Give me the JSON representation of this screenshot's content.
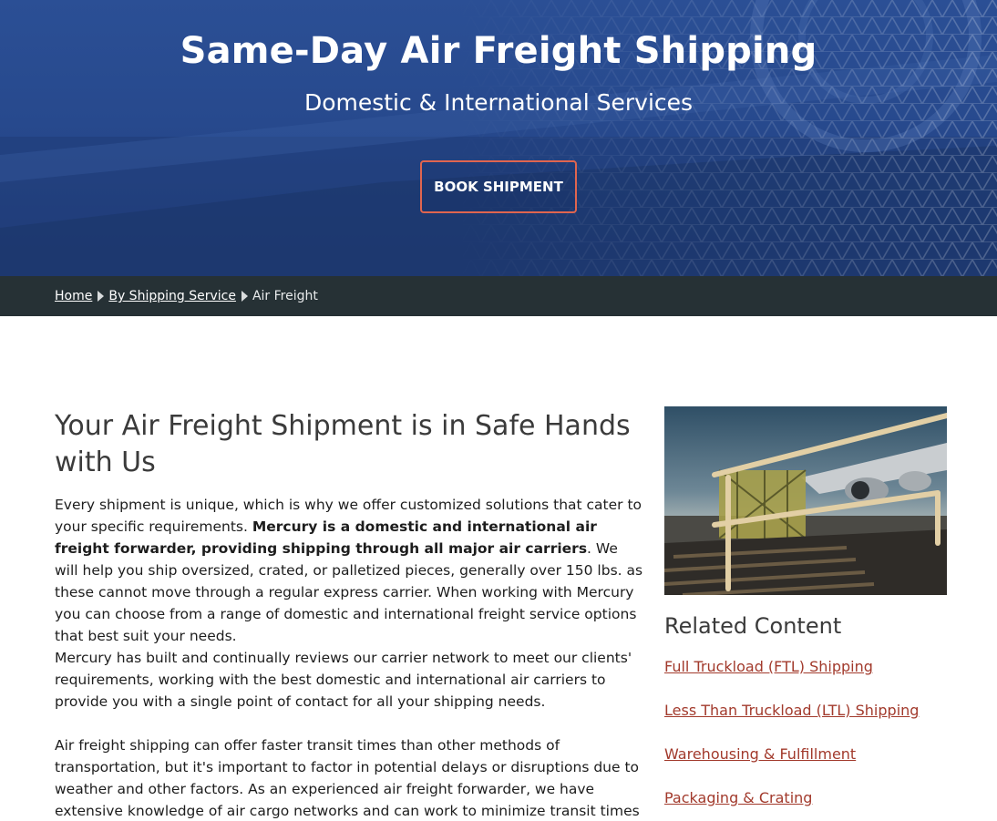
{
  "hero": {
    "title": "Same-Day Air Freight Shipping",
    "subtitle": "Domestic & International Services",
    "cta_label": "BOOK SHIPMENT"
  },
  "breadcrumb": {
    "items": [
      "Home",
      "By Shipping Service"
    ],
    "current": "Air Freight"
  },
  "main": {
    "heading": "Your Air Freight Shipment is in Safe Hands with Us",
    "p1_a": "Every shipment is unique, which is why we offer customized solutions that cater to your specific requirements. ",
    "p1_bold": "Mercury is a domestic and international air freight forwarder, providing shipping through all major air carriers",
    "p1_b": ". We will help you ship oversized, crated, or palletized pieces, generally over 150 lbs. as these cannot move through a regular express carrier. When working with Mercury you can choose from a range of domestic and international freight service options that best suit your needs.",
    "p2": "Mercury has built and continually reviews our carrier network to meet our clients' requirements, working with the best domestic and international air carriers to provide you with a single point of contact for all your shipping needs.",
    "p3": "Air freight shipping can offer faster transit times than other methods of transportation, but it's important to factor in potential delays or disruptions due to weather and other factors. As an experienced air freight forwarder, we have extensive knowledge of air cargo networks and can work to minimize transit times and ensure"
  },
  "sidebar": {
    "title": "Related Content",
    "links": [
      "Full Truckload (FTL) Shipping",
      "Less Than Truckload (LTL) Shipping",
      "Warehousing & Fulfillment",
      "Packaging & Crating"
    ]
  },
  "colors": {
    "hero_blue": "#27498d",
    "breadcrumb_bg": "#263135",
    "cta_border": "#e0654f",
    "link": "#a23a2c"
  }
}
